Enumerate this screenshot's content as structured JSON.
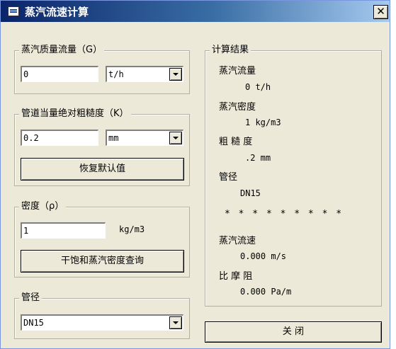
{
  "window": {
    "title": "蒸汽流速计算",
    "close_label": "✕"
  },
  "flow": {
    "legend": "蒸汽质量流量（G）",
    "value": "0",
    "unit": "t/h"
  },
  "roughness": {
    "legend": "管道当量绝对粗糙度（K）",
    "value": "0.2",
    "unit": "mm",
    "reset_label": "恢复默认值"
  },
  "density": {
    "legend": "密度（ρ）",
    "value": "1",
    "unit": "kg/m3",
    "lookup_label": "干饱和蒸汽密度查询"
  },
  "pipe": {
    "legend": "管径",
    "value": "DN15"
  },
  "results": {
    "legend": "计算结果",
    "flow_label": "蒸汽流量",
    "flow_value": "0 t/h",
    "density_label": "蒸汽密度",
    "density_value": "1 kg/m3",
    "roughness_label": "粗 糙 度",
    "roughness_value": ".2 mm",
    "pipe_label": "管径",
    "pipe_value": "DN15",
    "separator": "* * * * * * * * *",
    "velocity_label": "蒸汽流速",
    "velocity_value": "0.000 m/s",
    "friction_label": "比 摩 阻",
    "friction_value": "0.000 Pa/m"
  },
  "close_button": {
    "label": "关  闭"
  }
}
